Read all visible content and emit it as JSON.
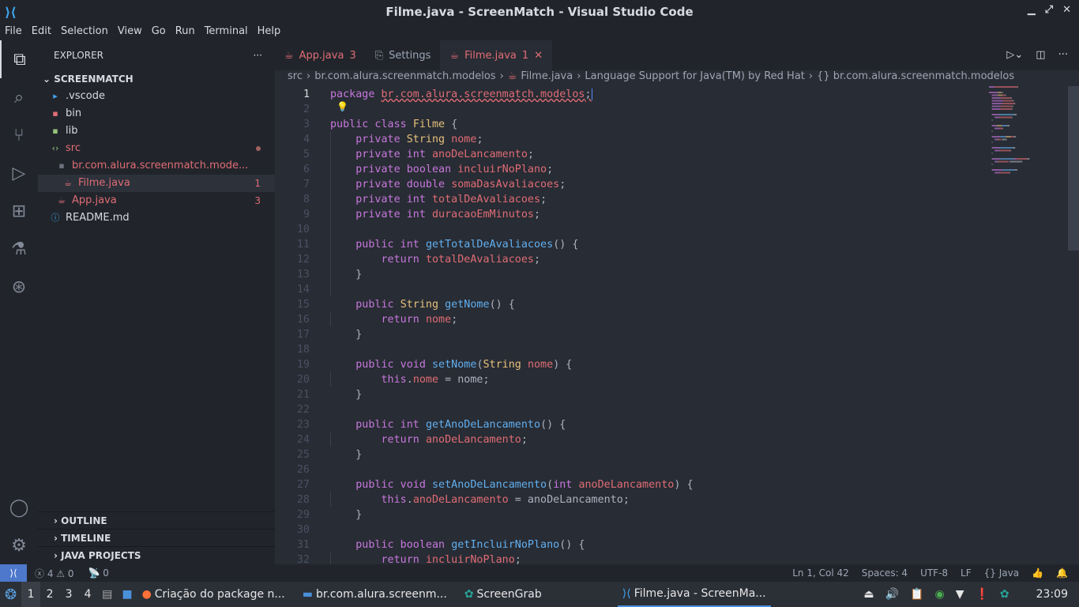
{
  "window": {
    "title": "Filme.java - ScreenMatch - Visual Studio Code"
  },
  "menu": [
    "File",
    "Edit",
    "Selection",
    "View",
    "Go",
    "Run",
    "Terminal",
    "Help"
  ],
  "activity": [
    {
      "icon": "files-icon"
    },
    {
      "icon": "search-icon"
    },
    {
      "icon": "source-control-icon"
    },
    {
      "icon": "run-debug-icon"
    },
    {
      "icon": "extensions-icon"
    },
    {
      "icon": "testing-icon"
    },
    {
      "icon": "git-graph-icon"
    }
  ],
  "explorer": {
    "title": "EXPLORER",
    "root": "SCREENMATCH",
    "items": [
      {
        "label": ".vscode",
        "icon": "folder-vscode-icon",
        "indent": 0
      },
      {
        "label": "bin",
        "icon": "folder-bin-icon",
        "indent": 0
      },
      {
        "label": "lib",
        "icon": "folder-lib-icon",
        "indent": 0
      },
      {
        "label": "src",
        "icon": "folder-src-icon",
        "indent": 0,
        "status": "dot",
        "error": true
      },
      {
        "label": "br.com.alura.screenmatch.mode...",
        "icon": "folder-icon",
        "indent": 1,
        "error": true
      },
      {
        "label": "Filme.java",
        "icon": "java-icon",
        "indent": 2,
        "badge": "1",
        "error": true,
        "selected": true
      },
      {
        "label": "App.java",
        "icon": "java-icon",
        "indent": 1,
        "badge": "3",
        "error": true
      },
      {
        "label": "README.md",
        "icon": "info-icon",
        "indent": 0
      }
    ],
    "panels": [
      "OUTLINE",
      "TIMELINE",
      "JAVA PROJECTS"
    ]
  },
  "tabs": [
    {
      "label": "App.java",
      "badge": "3",
      "icon": "java-icon"
    },
    {
      "label": "Settings",
      "icon": "settings-file-icon"
    },
    {
      "label": "Filme.java",
      "badge": "1",
      "icon": "java-icon",
      "active": true
    }
  ],
  "breadcrumbs": [
    "src",
    "br.com.alura.screenmatch.modelos",
    "Filme.java",
    "Language Support for Java(TM) by Red Hat",
    "{} br.com.alura.screenmatch.modelos"
  ],
  "code": [
    [
      [
        "package ",
        "k"
      ],
      [
        "br.com.alura.screenmatch.modelos",
        "f u"
      ],
      [
        ";",
        "p u"
      ]
    ],
    [],
    [
      [
        "public class ",
        "k"
      ],
      [
        "Filme",
        "t"
      ],
      [
        " {",
        "p"
      ]
    ],
    [
      [
        "    private ",
        "k"
      ],
      [
        "String ",
        "t"
      ],
      [
        "nome",
        "f"
      ],
      [
        ";",
        "p"
      ]
    ],
    [
      [
        "    private int ",
        "k"
      ],
      [
        "anoDeLancamento",
        "f"
      ],
      [
        ";",
        "p"
      ]
    ],
    [
      [
        "    private boolean ",
        "k"
      ],
      [
        "incluirNoPlano",
        "f"
      ],
      [
        ";",
        "p"
      ]
    ],
    [
      [
        "    private double ",
        "k"
      ],
      [
        "somaDasAvaliacoes",
        "f"
      ],
      [
        ";",
        "p"
      ]
    ],
    [
      [
        "    private int ",
        "k"
      ],
      [
        "totalDeAvaliacoes",
        "f"
      ],
      [
        ";",
        "p"
      ]
    ],
    [
      [
        "    private int ",
        "k"
      ],
      [
        "duracaoEmMinutos",
        "f"
      ],
      [
        ";",
        "p"
      ]
    ],
    [],
    [
      [
        "    public int ",
        "k"
      ],
      [
        "getTotalDeAvaliacoes",
        "m"
      ],
      [
        "() {",
        "p"
      ]
    ],
    [
      [
        "        return ",
        "k"
      ],
      [
        "totalDeAvaliacoes",
        "f"
      ],
      [
        ";",
        "p"
      ]
    ],
    [
      [
        "    }",
        "p"
      ]
    ],
    [],
    [
      [
        "    public ",
        "k"
      ],
      [
        "String ",
        "t"
      ],
      [
        "getNome",
        "m"
      ],
      [
        "() {",
        "p"
      ]
    ],
    [
      [
        "        return ",
        "k"
      ],
      [
        "nome",
        "f"
      ],
      [
        ";",
        "p"
      ]
    ],
    [
      [
        "    }",
        "p"
      ]
    ],
    [],
    [
      [
        "    public void ",
        "k"
      ],
      [
        "setNome",
        "m"
      ],
      [
        "(",
        "p"
      ],
      [
        "String ",
        "t"
      ],
      [
        "nome",
        "f"
      ],
      [
        ") {",
        "p"
      ]
    ],
    [
      [
        "        this",
        "k"
      ],
      [
        ".",
        "p"
      ],
      [
        "nome",
        "f"
      ],
      [
        " = nome;",
        "p"
      ]
    ],
    [
      [
        "    }",
        "p"
      ]
    ],
    [],
    [
      [
        "    public int ",
        "k"
      ],
      [
        "getAnoDeLancamento",
        "m"
      ],
      [
        "() {",
        "p"
      ]
    ],
    [
      [
        "        return ",
        "k"
      ],
      [
        "anoDeLancamento",
        "f"
      ],
      [
        ";",
        "p"
      ]
    ],
    [
      [
        "    }",
        "p"
      ]
    ],
    [],
    [
      [
        "    public void ",
        "k"
      ],
      [
        "setAnoDeLancamento",
        "m"
      ],
      [
        "(",
        "p"
      ],
      [
        "int ",
        "k"
      ],
      [
        "anoDeLancamento",
        "f"
      ],
      [
        ") {",
        "p"
      ]
    ],
    [
      [
        "        this",
        "k"
      ],
      [
        ".",
        "p"
      ],
      [
        "anoDeLancamento",
        "f"
      ],
      [
        " = anoDeLancamento;",
        "p"
      ]
    ],
    [
      [
        "    }",
        "p"
      ]
    ],
    [],
    [
      [
        "    public boolean ",
        "k"
      ],
      [
        "getIncluirNoPlano",
        "m"
      ],
      [
        "() {",
        "p"
      ]
    ],
    [
      [
        "        return ",
        "k"
      ],
      [
        "incluirNoPlano",
        "f"
      ],
      [
        ";",
        "p"
      ]
    ]
  ],
  "status": {
    "errors": "4",
    "warnings": "0",
    "ports": "0",
    "position": "Ln 1, Col 42",
    "spaces": "Spaces: 4",
    "encoding": "UTF-8",
    "eol": "LF",
    "language": "Java"
  },
  "taskbar": {
    "workspaces": [
      "1",
      "2",
      "3",
      "4"
    ],
    "apps": [
      {
        "label": "Criação do package n...",
        "icon": "firefox-icon"
      },
      {
        "label": "br.com.alura.screenm...",
        "icon": "folder-icon"
      },
      {
        "label": "ScreenGrab",
        "icon": "screengrab-icon"
      },
      {
        "label": "Filme.java - ScreenMa...",
        "icon": "vscode-icon",
        "active": true
      }
    ],
    "clock": "23:09"
  },
  "colors": {
    "accent": "#4d78cc",
    "error": "#e06c75",
    "keyword": "#c678dd",
    "type": "#e5c07b",
    "function": "#61afef"
  }
}
